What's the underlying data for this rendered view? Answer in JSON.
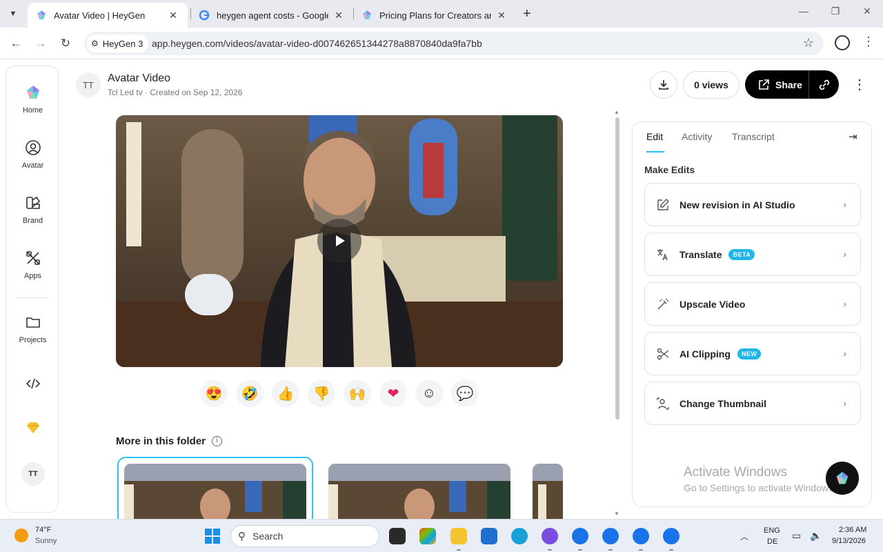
{
  "browser": {
    "tabs": [
      {
        "title": "Avatar Video | HeyGen",
        "active": true
      },
      {
        "title": "heygen agent costs - Google Se",
        "active": false
      },
      {
        "title": "Pricing Plans for Creators and M",
        "active": false
      }
    ],
    "site_chip": "HeyGen 3",
    "url": "app.heygen.com/videos/avatar-video-d007462651344278a8870840da9fa7bb"
  },
  "sidebar": {
    "items": [
      {
        "label": "Home",
        "icon": "heygen-logo-icon"
      },
      {
        "label": "Avatar",
        "icon": "avatar-icon"
      },
      {
        "label": "Brand",
        "icon": "brand-icon"
      },
      {
        "label": "Apps",
        "icon": "apps-icon"
      },
      {
        "label": "Projects",
        "icon": "folder-icon"
      }
    ],
    "user_initials": "TT"
  },
  "header": {
    "avatar_initials": "TT",
    "title": "Avatar Video",
    "meta": "Tcl Led tv · Created on Sep 12, 2026",
    "views": "0 views",
    "share_label": "Share"
  },
  "reactions": [
    "😍",
    "🤣",
    "👍",
    "👎",
    "🙌",
    "❤",
    "☺",
    "💬"
  ],
  "folder": {
    "title": "More in this folder"
  },
  "panel": {
    "tabs": [
      "Edit",
      "Activity",
      "Transcript"
    ],
    "section_title": "Make Edits",
    "actions": [
      {
        "label": "New revision in AI Studio",
        "badge": ""
      },
      {
        "label": "Translate",
        "badge": "BETA"
      },
      {
        "label": "Upscale Video",
        "badge": ""
      },
      {
        "label": "AI Clipping",
        "badge": "NEW"
      },
      {
        "label": "Change Thumbnail",
        "badge": ""
      }
    ],
    "watermark_title": "Activate Windows",
    "watermark_sub": "Go to Settings to activate Windows."
  },
  "taskbar": {
    "temp": "74°F",
    "condition": "Sunny",
    "search_placeholder": "Search",
    "lang_top": "ENG",
    "lang_bottom": "DE",
    "time": "2:36 AM",
    "date": "9/13/2026"
  },
  "colors": {
    "accent": "#2bc3f0",
    "badge": "#1fb6e8",
    "share_bg": "#000000"
  }
}
